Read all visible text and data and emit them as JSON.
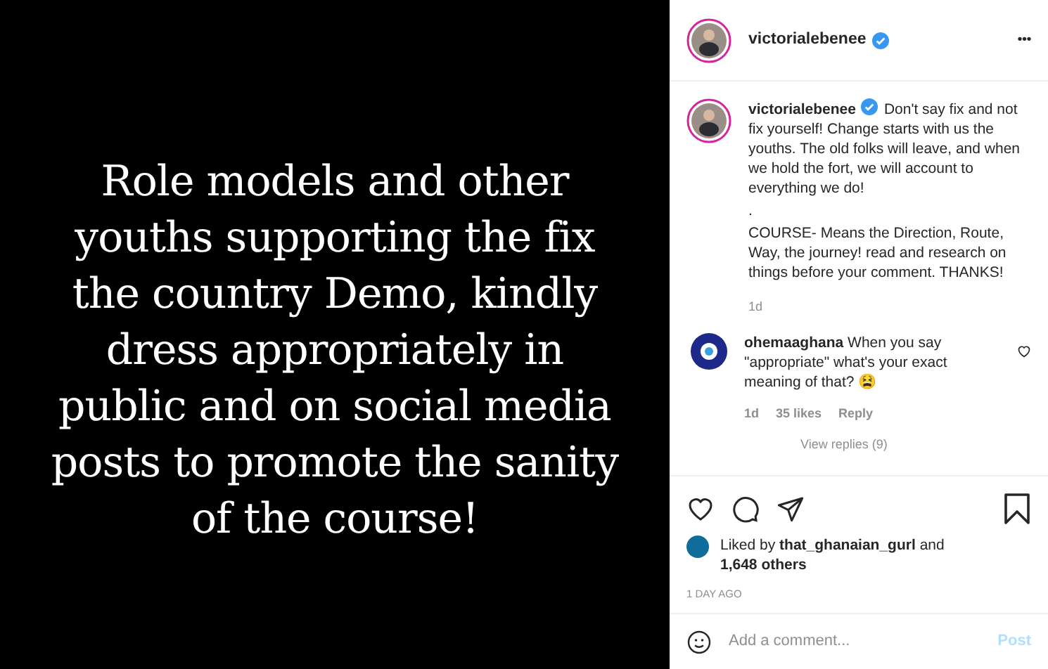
{
  "post_text_lines": [
    "Role models and other",
    "youths supporting the fix",
    "the country Demo, kindly",
    "dress appropriately in",
    "public and on social media",
    "posts to promote the sanity",
    "of the course!"
  ],
  "header": {
    "username": "victorialebenee",
    "verified": true,
    "more": "•••"
  },
  "caption": {
    "username": "victorialebenee",
    "verified": true,
    "paragraphs": [
      "Don't say fix and not fix yourself! Change starts with us the youths. The old folks will leave, and when we hold the fort, we will account to everything we do!",
      ".",
      "COURSE- Means the Direction, Route, Way, the journey! read and research on things before your comment. THANKS!"
    ],
    "time": "1d"
  },
  "comments": [
    {
      "username": "ohemaaghana",
      "text": "When you say \"appropriate\" what's your exact meaning of that? 😫",
      "time": "1d",
      "likes": "35 likes",
      "reply": "Reply",
      "liked": false,
      "view_replies": "View replies (9)"
    }
  ],
  "likes": {
    "liked_by": "Liked by",
    "user": "that_ghanaian_gurl",
    "and": "and",
    "others": "1,648 others"
  },
  "posted": "1 DAY AGO",
  "liked": false,
  "saved": false,
  "comment_box": {
    "placeholder": "Add a comment...",
    "post": "Post"
  }
}
